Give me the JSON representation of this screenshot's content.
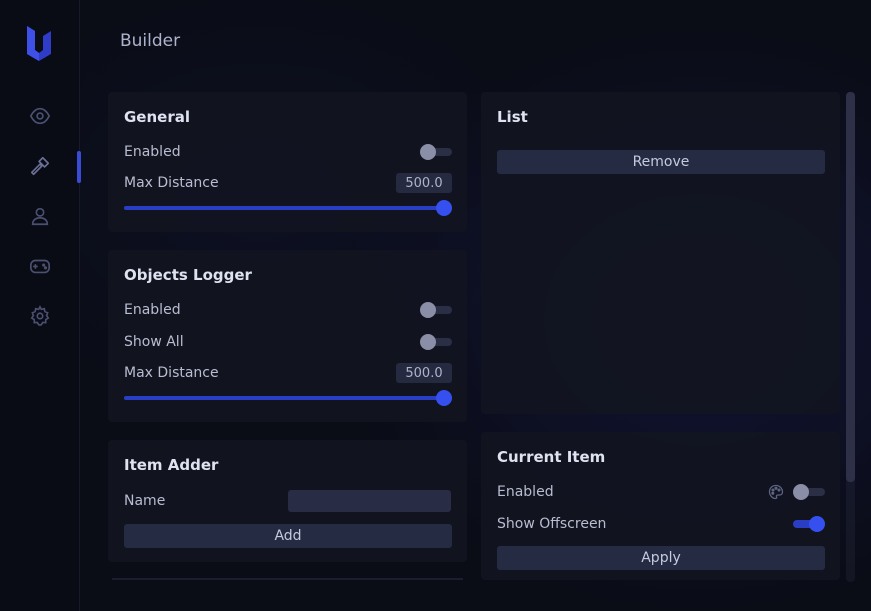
{
  "page": {
    "title": "Builder"
  },
  "sidebar": {
    "items": [
      {
        "id": "visuals",
        "icon": "eye-icon",
        "active": false
      },
      {
        "id": "builder",
        "icon": "hammer-icon",
        "active": true
      },
      {
        "id": "player",
        "icon": "user-icon",
        "active": false
      },
      {
        "id": "games",
        "icon": "gamepad-icon",
        "active": false
      },
      {
        "id": "settings",
        "icon": "gear-icon",
        "active": false
      }
    ]
  },
  "general": {
    "title": "General",
    "enabled_label": "Enabled",
    "enabled": false,
    "max_distance_label": "Max Distance",
    "max_distance_value": "500.0",
    "max_distance_fraction": 1.0
  },
  "objects_logger": {
    "title": "Objects Logger",
    "enabled_label": "Enabled",
    "enabled": false,
    "show_all_label": "Show All",
    "show_all": false,
    "max_distance_label": "Max Distance",
    "max_distance_value": "500.0",
    "max_distance_fraction": 1.0
  },
  "item_adder": {
    "title": "Item Adder",
    "name_label": "Name",
    "name_value": "",
    "add_label": "Add"
  },
  "list": {
    "title": "List",
    "remove_label": "Remove"
  },
  "current_item": {
    "title": "Current Item",
    "enabled_label": "Enabled",
    "enabled": false,
    "show_offscreen_label": "Show Offscreen",
    "show_offscreen": true,
    "apply_label": "Apply"
  },
  "colors": {
    "accent": "#3550ef",
    "panel": "#121420",
    "background": "#0a0c16"
  }
}
